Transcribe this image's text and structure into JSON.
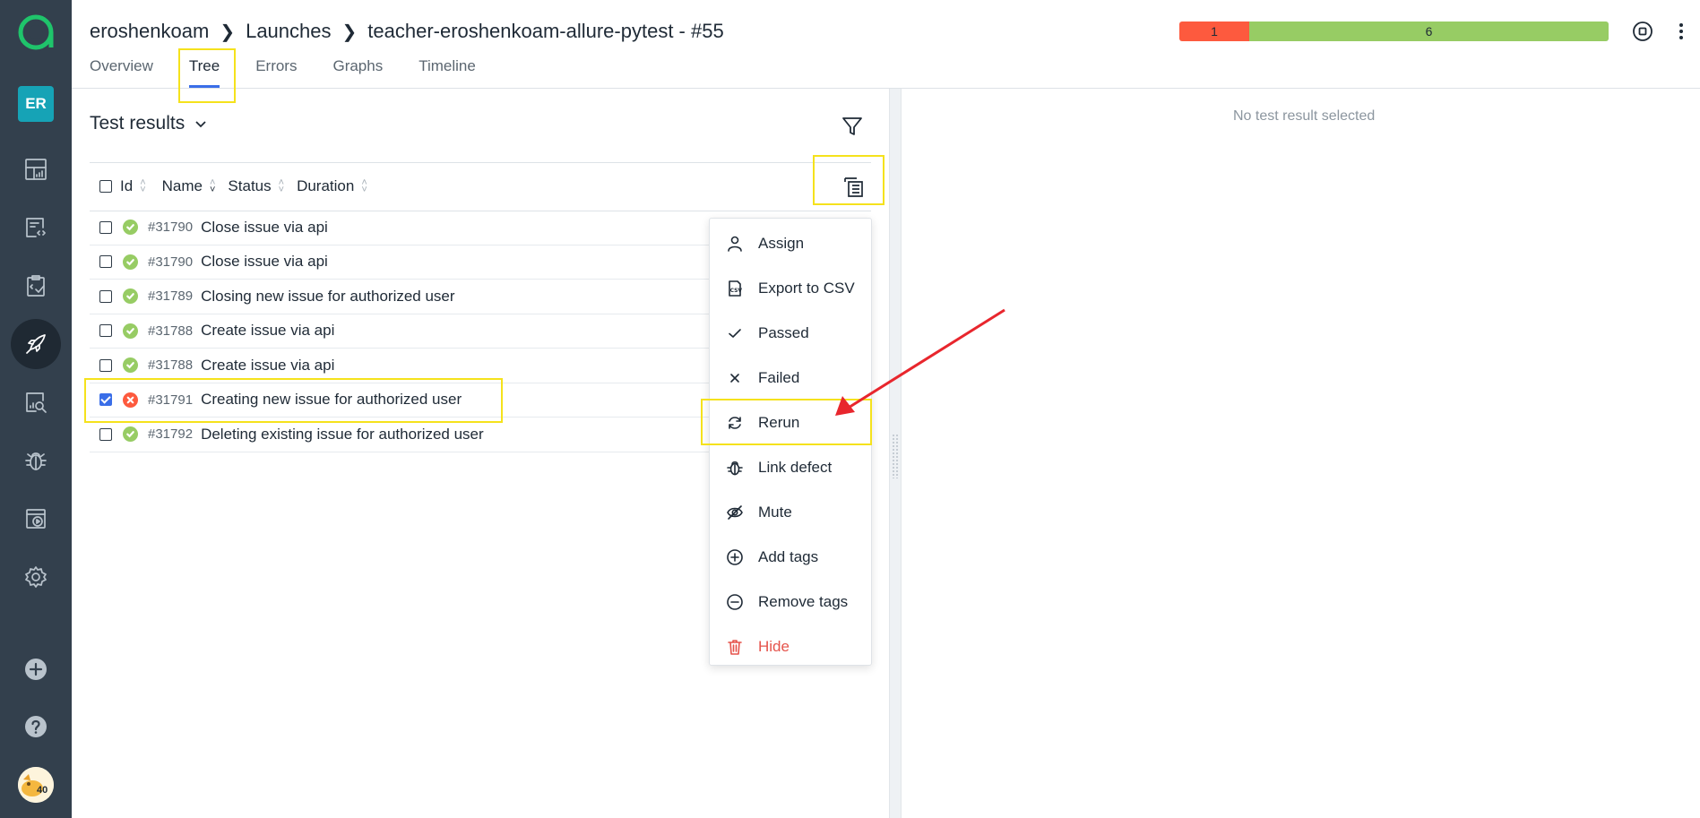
{
  "app": {
    "logo_icon": "allure-logo-icon",
    "user_initials": "ER",
    "user_avatar_badge": "40"
  },
  "sidebar": {
    "items": [
      {
        "name": "dashboards",
        "icon": "dashboard-icon",
        "active": false
      },
      {
        "name": "test-cases",
        "icon": "testcases-icon",
        "active": false
      },
      {
        "name": "test-plans",
        "icon": "testplans-icon",
        "active": false
      },
      {
        "name": "launches",
        "icon": "rocket-icon",
        "active": true
      },
      {
        "name": "analytics",
        "icon": "analytics-icon",
        "active": false
      },
      {
        "name": "defects",
        "icon": "bug-icon",
        "active": false
      },
      {
        "name": "jobs",
        "icon": "jobs-icon",
        "active": false
      },
      {
        "name": "settings",
        "icon": "gear-icon",
        "active": false
      }
    ],
    "bottom": [
      {
        "name": "add",
        "icon": "plus-circle-icon"
      },
      {
        "name": "help",
        "icon": "help-icon"
      }
    ]
  },
  "header": {
    "breadcrumb": [
      "eroshenkoam",
      "Launches",
      "teacher-eroshenkoam-allure-pytest - #55"
    ],
    "tabs": [
      "Overview",
      "Tree",
      "Errors",
      "Graphs",
      "Timeline"
    ],
    "active_tab": "Tree",
    "status": {
      "failed": "1",
      "passed": "6",
      "failed_fraction": 0.143,
      "failed_color": "#fd5a3e",
      "passed_color": "#97cc64"
    }
  },
  "panel": {
    "title": "Test results",
    "columns": [
      "Id",
      "Name",
      "Status",
      "Duration"
    ],
    "rows": [
      {
        "id": "#31790",
        "name": "Close issue via api",
        "status": "passed",
        "checked": false
      },
      {
        "id": "#31790",
        "name": "Close issue via api",
        "status": "passed",
        "checked": false
      },
      {
        "id": "#31789",
        "name": "Closing new issue for authorized user",
        "status": "passed",
        "checked": false
      },
      {
        "id": "#31788",
        "name": "Create issue via api",
        "status": "passed",
        "checked": false
      },
      {
        "id": "#31788",
        "name": "Create issue via api",
        "status": "passed",
        "checked": false
      },
      {
        "id": "#31791",
        "name": "Creating new issue for authorized user",
        "status": "failed",
        "checked": true
      },
      {
        "id": "#31792",
        "name": "Deleting existing issue for authorized user",
        "status": "passed",
        "checked": false
      }
    ]
  },
  "detail": {
    "empty_text": "No test result selected"
  },
  "menu": {
    "items": [
      {
        "label": "Assign",
        "icon": "user-icon"
      },
      {
        "label": "Export to CSV",
        "icon": "csv-icon"
      },
      {
        "label": "Passed",
        "icon": "check-icon"
      },
      {
        "label": "Failed",
        "icon": "x-icon"
      },
      {
        "label": "Rerun",
        "icon": "refresh-icon"
      },
      {
        "label": "Link defect",
        "icon": "bug-icon"
      },
      {
        "label": "Mute",
        "icon": "eye-off-icon"
      },
      {
        "label": "Add tags",
        "icon": "plus-circle-icon"
      },
      {
        "label": "Remove tags",
        "icon": "minus-circle-icon"
      },
      {
        "label": "Hide",
        "icon": "trash-icon",
        "danger": true
      }
    ]
  },
  "annotations": {
    "highlight_color": "#f5e21c",
    "arrow_color": "#e8262d"
  }
}
